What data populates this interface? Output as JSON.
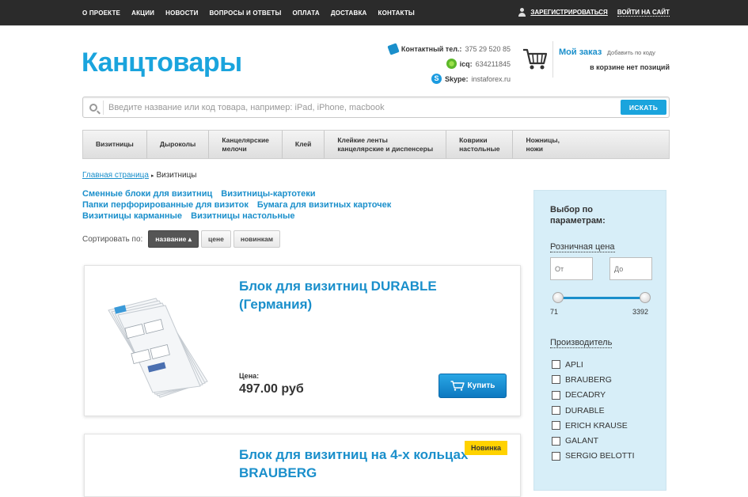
{
  "topnav": {
    "items": [
      "О ПРОЕКТЕ",
      "АКЦИИ",
      "НОВОСТИ",
      "ВОПРОСЫ И ОТВЕТЫ",
      "ОПЛАТА",
      "ДОСТАВКА",
      "КОНТАКТЫ"
    ],
    "register": "ЗАРЕГИСТРИРОВАТЬСЯ",
    "login": "ВОЙТИ НА САЙТ"
  },
  "header": {
    "logo": "Канцтовары",
    "phone_label": "Контактный тел.:",
    "phone": "375 29 520 85",
    "icq_label": "icq:",
    "icq": "634211845",
    "skype_label": "Skype:",
    "skype": "instaforex.ru",
    "order_title": "Мой заказ",
    "order_hint": "Добавить по коду",
    "order_empty": "в корзине нет позиций"
  },
  "search": {
    "placeholder": "Введите название или код товара, например: iPad, iPhone, macbook",
    "button": "ИСКАТЬ"
  },
  "categories": [
    [
      "Визитницы"
    ],
    [
      "Дыроколы"
    ],
    [
      "Канцелярские",
      "мелочи"
    ],
    [
      "Клей"
    ],
    [
      "Клейкие ленты",
      "канцелярские и диспенсеры"
    ],
    [
      "Коврики",
      "настольные"
    ],
    [
      "Ножницы,",
      "ножи"
    ]
  ],
  "breadcrumb": {
    "home": "Главная страница",
    "current": "Визитницы"
  },
  "subcats": [
    [
      "Сменные блоки для визитниц",
      "Визитницы-картотеки"
    ],
    [
      "Папки перфорированные для визиток",
      "Бумага для визитных карточек"
    ],
    [
      "Визитницы карманные",
      "Визитницы настольные"
    ]
  ],
  "sort": {
    "label": "Сортировать по:",
    "options": [
      "название ▴",
      "цене",
      "новинкам"
    ]
  },
  "products": [
    {
      "title": "Блок для визитниц DURABLE (Германия)",
      "price_label": "Цена:",
      "price": "497.00 руб",
      "buy": "Купить"
    },
    {
      "title": "Блок для визитниц на 4-х кольцах BRAUBERG",
      "badge": "Новинка"
    }
  ],
  "filter": {
    "title": "Выбор по параметрам:",
    "price_label": "Розничная цена",
    "from_placeholder": "От",
    "to_placeholder": "До",
    "min": "71",
    "max": "3392",
    "makers_label": "Производитель",
    "makers": [
      "APLI",
      "BRAUBERG",
      "DECADRY",
      "DURABLE",
      "ERICH KRAUSE",
      "GALANT",
      "SERGIO BELOTTI"
    ]
  },
  "colors": {
    "accent": "#1aa4dd",
    "link": "#1a8fcb",
    "topbar": "#2b2b2b",
    "badge": "#ffd200",
    "filter_bg": "#d7eef8"
  }
}
